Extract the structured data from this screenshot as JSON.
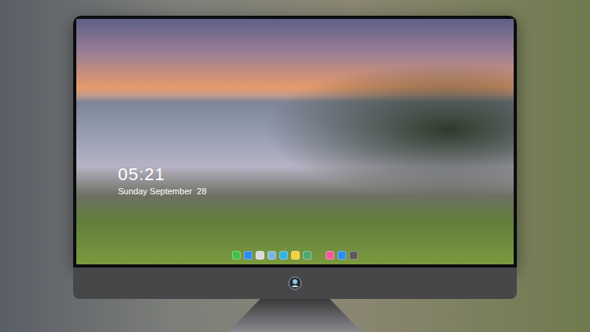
{
  "lock_screen": {
    "time": "05:21",
    "date": "Sunday September  28"
  },
  "dock": {
    "pinned": [
      {
        "color": "#3ec14a"
      },
      {
        "color": "#2f8ae8"
      },
      {
        "color": "#d9d9d9"
      },
      {
        "color": "#7ab8d8"
      },
      {
        "color": "#36b2dc"
      },
      {
        "color": "#f3cf3e"
      },
      {
        "color": "#4fa86a"
      }
    ],
    "extra": [
      {
        "color": "#f35b98"
      },
      {
        "color": "#2a8df0"
      },
      {
        "color": "#5a5a5c"
      }
    ]
  }
}
